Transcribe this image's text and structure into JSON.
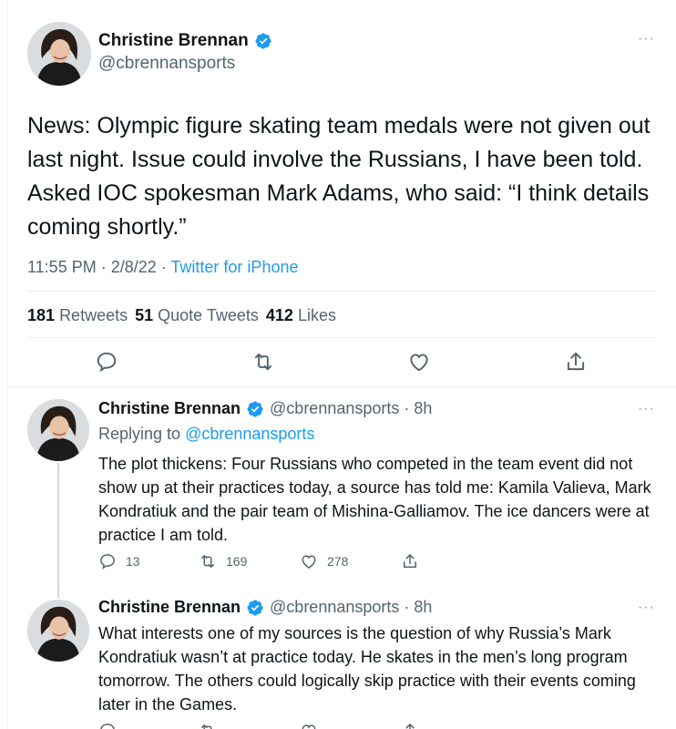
{
  "main_tweet": {
    "author_name": "Christine Brennan",
    "handle": "@cbrennansports",
    "text": "News: Olympic figure skating team medals were not given out last night. Issue could involve the Russians, I have been told. Asked IOC spokesman Mark Adams, who said: “I think details coming shortly.”",
    "time": "11:55 PM · 2/8/22 · ",
    "source": "Twitter for iPhone",
    "more_label": "···",
    "stats": {
      "retweets_count": "181",
      "retweets_label": "Retweets",
      "quotes_count": "51",
      "quotes_label": "Quote Tweets",
      "likes_count": "412",
      "likes_label": "Likes"
    }
  },
  "replies": [
    {
      "author_name": "Christine Brennan",
      "handle_time": "@cbrennansports · 8h",
      "replying_prefix": "Replying to ",
      "replying_to": "@cbrennansports",
      "text": "The plot thickens: Four Russians who competed in the team event did not show up at their practices today, a source has told me: Kamila Valieva, Mark Kondratiuk and the pair team of Mishina-Galliamov. The ice dancers were at practice I am told.",
      "reply_count": "13",
      "retweet_count": "169",
      "like_count": "278",
      "more_label": "···"
    },
    {
      "author_name": "Christine Brennan",
      "handle_time": "@cbrennansports · 8h",
      "text": "What interests one of my sources is the question of why Russia’s Mark Kondratiuk wasn’t at practice today. He skates in the men’s long program tomorrow. The others could logically skip practice with their events coming later in the Games.",
      "more_label": "···"
    }
  ],
  "colors": {
    "accent": "#1d9bf0",
    "secondary_text": "#536471",
    "verified": "#1d9bf0"
  },
  "icons": [
    "verified-badge-icon",
    "reply-icon",
    "retweet-icon",
    "like-icon",
    "share-icon",
    "more-icon"
  ]
}
